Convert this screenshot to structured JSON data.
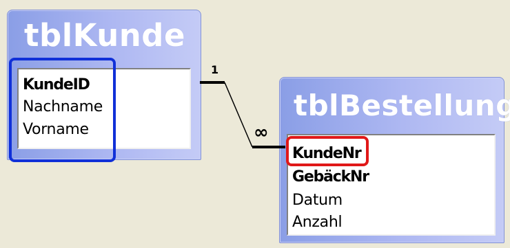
{
  "relationship_window": {
    "tables": [
      {
        "name": "tblKunde",
        "fields": [
          {
            "label": "KundeID",
            "primary_key": true
          },
          {
            "label": "Nachname",
            "primary_key": false
          },
          {
            "label": "Vorname",
            "primary_key": false
          }
        ]
      },
      {
        "name": "tblBestellung",
        "fields": [
          {
            "label": "KundeNr",
            "primary_key": true
          },
          {
            "label": "GebäckNr",
            "primary_key": true
          },
          {
            "label": "Datum",
            "primary_key": false
          },
          {
            "label": "Anzahl",
            "primary_key": false
          }
        ]
      }
    ],
    "relationship": {
      "one_side_label": "1",
      "many_side_label": "∞"
    },
    "colors": {
      "blue_highlight": "#1030d8",
      "red_highlight": "#e01818",
      "title_bar": "#aeb8f2",
      "background": "#ece9d8"
    }
  }
}
